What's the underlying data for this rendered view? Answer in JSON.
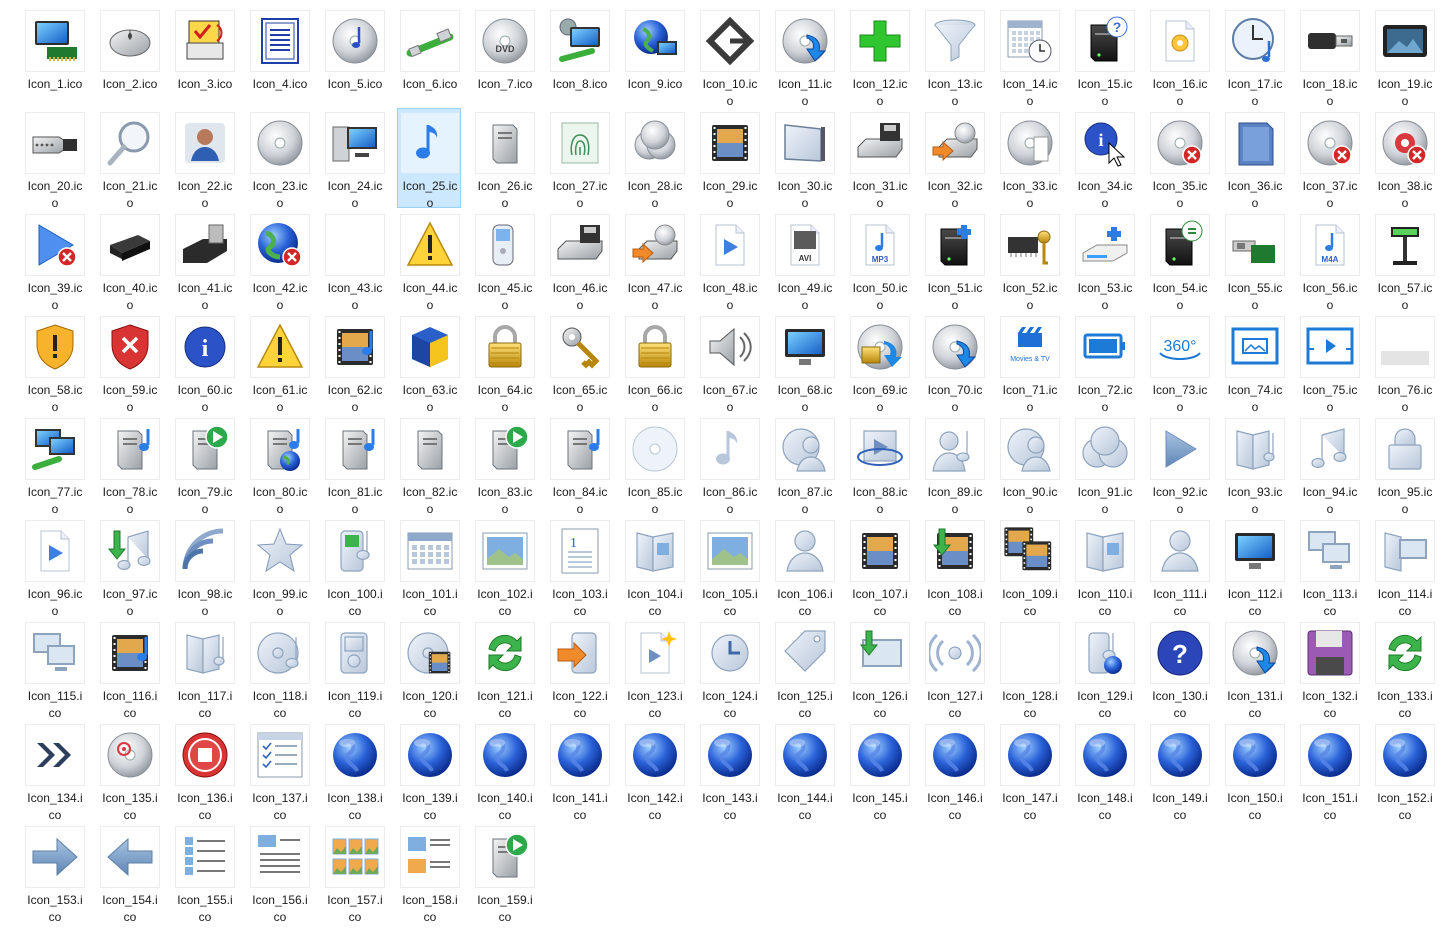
{
  "window": {
    "view": "Large icons"
  },
  "selected_index": 24,
  "items": [
    {
      "l1": "Icon_1.ico",
      "l2": "",
      "icon": "computer-network-icon"
    },
    {
      "l1": "Icon_2.ico",
      "l2": "",
      "icon": "mouse-icon"
    },
    {
      "l1": "Icon_3.ico",
      "l2": "",
      "icon": "printer-check-icon"
    },
    {
      "l1": "Icon_4.ico",
      "l2": "",
      "icon": "document-icon"
    },
    {
      "l1": "Icon_5.ico",
      "l2": "",
      "icon": "cd-music-icon"
    },
    {
      "l1": "Icon_6.ico",
      "l2": "",
      "icon": "network-cable-icon"
    },
    {
      "l1": "Icon_7.ico",
      "l2": "",
      "icon": "dvd-icon"
    },
    {
      "l1": "Icon_8.ico",
      "l2": "",
      "icon": "computer-settings-icon"
    },
    {
      "l1": "Icon_9.ico",
      "l2": "",
      "icon": "globe-monitor-icon"
    },
    {
      "l1": "Icon_10.ic",
      "l2": "o",
      "icon": "diamond-arrow-icon"
    },
    {
      "l1": "Icon_11.ic",
      "l2": "o",
      "icon": "cd-arrow-icon"
    },
    {
      "l1": "Icon_12.ic",
      "l2": "o",
      "icon": "green-plus-icon"
    },
    {
      "l1": "Icon_13.ic",
      "l2": "o",
      "icon": "funnel-icon"
    },
    {
      "l1": "Icon_14.ic",
      "l2": "o",
      "icon": "calendar-clock-icon"
    },
    {
      "l1": "Icon_15.ic",
      "l2": "o",
      "icon": "server-help-icon"
    },
    {
      "l1": "Icon_16.ic",
      "l2": "o",
      "icon": "settings-file-icon"
    },
    {
      "l1": "Icon_17.ic",
      "l2": "o",
      "icon": "clock-music-icon"
    },
    {
      "l1": "Icon_18.ic",
      "l2": "o",
      "icon": "usb-connector-icon"
    },
    {
      "l1": "Icon_19.ic",
      "l2": "o",
      "icon": "media-device-icon"
    },
    {
      "l1": "Icon_20.ic",
      "l2": "o",
      "icon": "serial-port-icon"
    },
    {
      "l1": "Icon_21.ic",
      "l2": "o",
      "icon": "magnifier-icon"
    },
    {
      "l1": "Icon_22.ic",
      "l2": "o",
      "icon": "user-icon"
    },
    {
      "l1": "Icon_23.ic",
      "l2": "o",
      "icon": "cd-icon"
    },
    {
      "l1": "Icon_24.ic",
      "l2": "o",
      "icon": "computer-icon"
    },
    {
      "l1": "Icon_25.ic",
      "l2": "o",
      "icon": "music-note-icon"
    },
    {
      "l1": "Icon_26.ic",
      "l2": "o",
      "icon": "server-tower-icon"
    },
    {
      "l1": "Icon_27.ic",
      "l2": "o",
      "icon": "fingerprint-icon"
    },
    {
      "l1": "Icon_28.ic",
      "l2": "o",
      "icon": "cd-stack-icon"
    },
    {
      "l1": "Icon_29.ic",
      "l2": "o",
      "icon": "film-icon"
    },
    {
      "l1": "Icon_30.ic",
      "l2": "o",
      "icon": "panel-icon"
    },
    {
      "l1": "Icon_31.ic",
      "l2": "o",
      "icon": "floppy-drive-icon"
    },
    {
      "l1": "Icon_32.ic",
      "l2": "o",
      "icon": "drive-arrow-icon"
    },
    {
      "l1": "Icon_33.ic",
      "l2": "o",
      "icon": "cd-file-icon"
    },
    {
      "l1": "Icon_34.ic",
      "l2": "o",
      "icon": "info-cursor-icon"
    },
    {
      "l1": "Icon_35.ic",
      "l2": "o",
      "icon": "cd-error-icon"
    },
    {
      "l1": "Icon_36.ic",
      "l2": "o",
      "icon": "memory-card-icon"
    },
    {
      "l1": "Icon_37.ic",
      "l2": "o",
      "icon": "cd-error-icon"
    },
    {
      "l1": "Icon_38.ic",
      "l2": "o",
      "icon": "cd-red-error-icon"
    },
    {
      "l1": "Icon_39.ic",
      "l2": "o",
      "icon": "play-error-icon"
    },
    {
      "l1": "Icon_40.ic",
      "l2": "o",
      "icon": "usb-drive-icon"
    },
    {
      "l1": "Icon_41.ic",
      "l2": "o",
      "icon": "card-reader-icon"
    },
    {
      "l1": "Icon_42.ic",
      "l2": "o",
      "icon": "globe-error-icon"
    },
    {
      "l1": "Icon_43.ic",
      "l2": "o",
      "icon": "blank-icon"
    },
    {
      "l1": "Icon_44.ic",
      "l2": "o",
      "icon": "warning-icon"
    },
    {
      "l1": "Icon_45.ic",
      "l2": "o",
      "icon": "phone-icon"
    },
    {
      "l1": "Icon_46.ic",
      "l2": "o",
      "icon": "floppy-drive-icon"
    },
    {
      "l1": "Icon_47.ic",
      "l2": "o",
      "icon": "drive-arrow-icon"
    },
    {
      "l1": "Icon_48.ic",
      "l2": "o",
      "icon": "video-file-icon"
    },
    {
      "l1": "Icon_49.ic",
      "l2": "o",
      "icon": "avi-file-icon"
    },
    {
      "l1": "Icon_50.ic",
      "l2": "o",
      "icon": "mp3-file-icon"
    },
    {
      "l1": "Icon_51.ic",
      "l2": "o",
      "icon": "server-plugin-icon"
    },
    {
      "l1": "Icon_52.ic",
      "l2": "o",
      "icon": "chip-key-icon"
    },
    {
      "l1": "Icon_53.ic",
      "l2": "o",
      "icon": "scanner-plugin-icon"
    },
    {
      "l1": "Icon_54.ic",
      "l2": "o",
      "icon": "server-sync-icon"
    },
    {
      "l1": "Icon_55.ic",
      "l2": "o",
      "icon": "usb-card-icon"
    },
    {
      "l1": "Icon_56.ic",
      "l2": "o",
      "icon": "m4a-file-icon"
    },
    {
      "l1": "Icon_57.ic",
      "l2": "o",
      "icon": "pole-display-icon"
    },
    {
      "l1": "Icon_58.ic",
      "l2": "o",
      "icon": "shield-warning-icon"
    },
    {
      "l1": "Icon_59.ic",
      "l2": "o",
      "icon": "shield-error-icon"
    },
    {
      "l1": "Icon_60.ic",
      "l2": "o",
      "icon": "info-icon"
    },
    {
      "l1": "Icon_61.ic",
      "l2": "o",
      "icon": "warning-icon"
    },
    {
      "l1": "Icon_62.ic",
      "l2": "o",
      "icon": "film-music-icon"
    },
    {
      "l1": "Icon_63.ic",
      "l2": "o",
      "icon": "cube-icon"
    },
    {
      "l1": "Icon_64.ic",
      "l2": "o",
      "icon": "lock-icon"
    },
    {
      "l1": "Icon_65.ic",
      "l2": "o",
      "icon": "keys-icon"
    },
    {
      "l1": "Icon_66.ic",
      "l2": "o",
      "icon": "lock-icon"
    },
    {
      "l1": "Icon_67.ic",
      "l2": "o",
      "icon": "speaker-icon"
    },
    {
      "l1": "Icon_68.ic",
      "l2": "o",
      "icon": "monitor-icon"
    },
    {
      "l1": "Icon_69.ic",
      "l2": "o",
      "icon": "cd-lock-icon"
    },
    {
      "l1": "Icon_70.ic",
      "l2": "o",
      "icon": "cd-arrow-icon"
    },
    {
      "l1": "Icon_71.ic",
      "l2": "o",
      "icon": "movies-tv-icon",
      "text": "Movies & TV"
    },
    {
      "l1": "Icon_72.ic",
      "l2": "o",
      "icon": "battery-icon"
    },
    {
      "l1": "Icon_73.ic",
      "l2": "o",
      "icon": "view-360-icon",
      "text": "360°"
    },
    {
      "l1": "Icon_74.ic",
      "l2": "o",
      "icon": "photo-frame-icon"
    },
    {
      "l1": "Icon_75.ic",
      "l2": "o",
      "icon": "play-frame-icon"
    },
    {
      "l1": "Icon_76.ic",
      "l2": "o",
      "icon": "gray-bar-icon"
    },
    {
      "l1": "Icon_77.ic",
      "l2": "o",
      "icon": "computers-network-icon"
    },
    {
      "l1": "Icon_78.ic",
      "l2": "o",
      "icon": "server-music-icon"
    },
    {
      "l1": "Icon_79.ic",
      "l2": "o",
      "icon": "server-play-icon"
    },
    {
      "l1": "Icon_80.ic",
      "l2": "o",
      "icon": "server-globe-icon"
    },
    {
      "l1": "Icon_81.ic",
      "l2": "o",
      "icon": "server-music-icon"
    },
    {
      "l1": "Icon_82.ic",
      "l2": "o",
      "icon": "server-tower-icon"
    },
    {
      "l1": "Icon_83.ic",
      "l2": "o",
      "icon": "server-play-icon"
    },
    {
      "l1": "Icon_84.ic",
      "l2": "o",
      "icon": "server-music-icon"
    },
    {
      "l1": "Icon_85.ic",
      "l2": "o",
      "icon": "disc-faded-icon"
    },
    {
      "l1": "Icon_86.ic",
      "l2": "o",
      "icon": "music-note-faded-icon"
    },
    {
      "l1": "Icon_87.ic",
      "l2": "o",
      "icon": "disc-user-icon"
    },
    {
      "l1": "Icon_88.ic",
      "l2": "o",
      "icon": "video-orbit-icon"
    },
    {
      "l1": "Icon_89.ic",
      "l2": "o",
      "icon": "user-music-icon"
    },
    {
      "l1": "Icon_90.ic",
      "l2": "o",
      "icon": "disc-user-icon"
    },
    {
      "l1": "Icon_91.ic",
      "l2": "o",
      "icon": "disc-stack-icon"
    },
    {
      "l1": "Icon_92.ic",
      "l2": "o",
      "icon": "play-icon"
    },
    {
      "l1": "Icon_93.ic",
      "l2": "o",
      "icon": "book-music-icon"
    },
    {
      "l1": "Icon_94.ic",
      "l2": "o",
      "icon": "music-notes-icon"
    },
    {
      "l1": "Icon_95.ic",
      "l2": "o",
      "icon": "padlock-icon"
    },
    {
      "l1": "Icon_96.ic",
      "l2": "o",
      "icon": "video-file-icon"
    },
    {
      "l1": "Icon_97.ic",
      "l2": "o",
      "icon": "music-download-icon"
    },
    {
      "l1": "Icon_98.ic",
      "l2": "o",
      "icon": "signal-icon"
    },
    {
      "l1": "Icon_99.ic",
      "l2": "o",
      "icon": "star-icon"
    },
    {
      "l1": "Icon_100.i",
      "l2": "co",
      "icon": "media-player-icon"
    },
    {
      "l1": "Icon_101.i",
      "l2": "co",
      "icon": "calendar-icon"
    },
    {
      "l1": "Icon_102.i",
      "l2": "co",
      "icon": "picture-icon"
    },
    {
      "l1": "Icon_103.i",
      "l2": "co",
      "icon": "numbered-doc-icon"
    },
    {
      "l1": "Icon_104.i",
      "l2": "co",
      "icon": "book-picture-icon"
    },
    {
      "l1": "Icon_105.i",
      "l2": "co",
      "icon": "picture-icon"
    },
    {
      "l1": "Icon_106.i",
      "l2": "co",
      "icon": "person-icon"
    },
    {
      "l1": "Icon_107.i",
      "l2": "co",
      "icon": "film-icon"
    },
    {
      "l1": "Icon_108.i",
      "l2": "co",
      "icon": "film-download-icon"
    },
    {
      "l1": "Icon_109.i",
      "l2": "co",
      "icon": "film-stack-icon"
    },
    {
      "l1": "Icon_110.i",
      "l2": "co",
      "icon": "book-picture-icon"
    },
    {
      "l1": "Icon_111.i",
      "l2": "co",
      "icon": "person-icon"
    },
    {
      "l1": "Icon_112.i",
      "l2": "co",
      "icon": "monitor-icon"
    },
    {
      "l1": "Icon_113.i",
      "l2": "co",
      "icon": "monitors-icon"
    },
    {
      "l1": "Icon_114.i",
      "l2": "co",
      "icon": "book-monitor-icon"
    },
    {
      "l1": "Icon_115.i",
      "l2": "co",
      "icon": "monitors-icon"
    },
    {
      "l1": "Icon_116.i",
      "l2": "co",
      "icon": "film-music-icon"
    },
    {
      "l1": "Icon_117.i",
      "l2": "co",
      "icon": "book-music-icon"
    },
    {
      "l1": "Icon_118.i",
      "l2": "co",
      "icon": "disc-music-icon"
    },
    {
      "l1": "Icon_119.i",
      "l2": "co",
      "icon": "ipod-icon"
    },
    {
      "l1": "Icon_120.i",
      "l2": "co",
      "icon": "disc-film-icon"
    },
    {
      "l1": "Icon_121.i",
      "l2": "co",
      "icon": "sync-icon"
    },
    {
      "l1": "Icon_122.i",
      "l2": "co",
      "icon": "device-arrow-icon"
    },
    {
      "l1": "Icon_123.i",
      "l2": "co",
      "icon": "video-new-icon"
    },
    {
      "l1": "Icon_124.i",
      "l2": "co",
      "icon": "recent-icon"
    },
    {
      "l1": "Icon_125.i",
      "l2": "co",
      "icon": "tag-icon"
    },
    {
      "l1": "Icon_126.i",
      "l2": "co",
      "icon": "monitor-download-icon"
    },
    {
      "l1": "Icon_127.i",
      "l2": "co",
      "icon": "broadcast-icon"
    },
    {
      "l1": "Icon_128.i",
      "l2": "co",
      "icon": "blank-icon"
    },
    {
      "l1": "Icon_129.i",
      "l2": "co",
      "icon": "media-globe-icon"
    },
    {
      "l1": "Icon_130.i",
      "l2": "co",
      "icon": "help-icon"
    },
    {
      "l1": "Icon_131.i",
      "l2": "co",
      "icon": "cd-arrow-icon"
    },
    {
      "l1": "Icon_132.i",
      "l2": "co",
      "icon": "floppy-icon"
    },
    {
      "l1": "Icon_133.i",
      "l2": "co",
      "icon": "sync-icon"
    },
    {
      "l1": "Icon_134.i",
      "l2": "co",
      "icon": "fast-forward-icon"
    },
    {
      "l1": "Icon_135.i",
      "l2": "co",
      "icon": "cd-record-icon"
    },
    {
      "l1": "Icon_136.i",
      "l2": "co",
      "icon": "stop-icon"
    },
    {
      "l1": "Icon_137.i",
      "l2": "co",
      "icon": "checklist-icon"
    },
    {
      "l1": "Icon_138.i",
      "l2": "co",
      "icon": "globe-icon"
    },
    {
      "l1": "Icon_139.i",
      "l2": "co",
      "icon": "globe-icon"
    },
    {
      "l1": "Icon_140.i",
      "l2": "co",
      "icon": "globe-icon"
    },
    {
      "l1": "Icon_141.i",
      "l2": "co",
      "icon": "globe-icon"
    },
    {
      "l1": "Icon_142.i",
      "l2": "co",
      "icon": "globe-icon"
    },
    {
      "l1": "Icon_143.i",
      "l2": "co",
      "icon": "globe-icon"
    },
    {
      "l1": "Icon_144.i",
      "l2": "co",
      "icon": "globe-icon"
    },
    {
      "l1": "Icon_145.i",
      "l2": "co",
      "icon": "globe-icon"
    },
    {
      "l1": "Icon_146.i",
      "l2": "co",
      "icon": "globe-icon"
    },
    {
      "l1": "Icon_147.i",
      "l2": "co",
      "icon": "globe-icon"
    },
    {
      "l1": "Icon_148.i",
      "l2": "co",
      "icon": "globe-icon"
    },
    {
      "l1": "Icon_149.i",
      "l2": "co",
      "icon": "globe-icon"
    },
    {
      "l1": "Icon_150.i",
      "l2": "co",
      "icon": "globe-icon"
    },
    {
      "l1": "Icon_151.i",
      "l2": "co",
      "icon": "globe-icon"
    },
    {
      "l1": "Icon_152.i",
      "l2": "co",
      "icon": "globe-icon"
    },
    {
      "l1": "Icon_153.i",
      "l2": "co",
      "icon": "arrow-right-icon"
    },
    {
      "l1": "Icon_154.i",
      "l2": "co",
      "icon": "arrow-left-icon"
    },
    {
      "l1": "Icon_155.i",
      "l2": "co",
      "icon": "picture-list-icon"
    },
    {
      "l1": "Icon_156.i",
      "l2": "co",
      "icon": "picture-details-icon"
    },
    {
      "l1": "Icon_157.i",
      "l2": "co",
      "icon": "picture-grid-icon"
    },
    {
      "l1": "Icon_158.i",
      "l2": "co",
      "icon": "picture-tiles-icon"
    },
    {
      "l1": "Icon_159.i",
      "l2": "co",
      "icon": "server-play-icon"
    }
  ]
}
